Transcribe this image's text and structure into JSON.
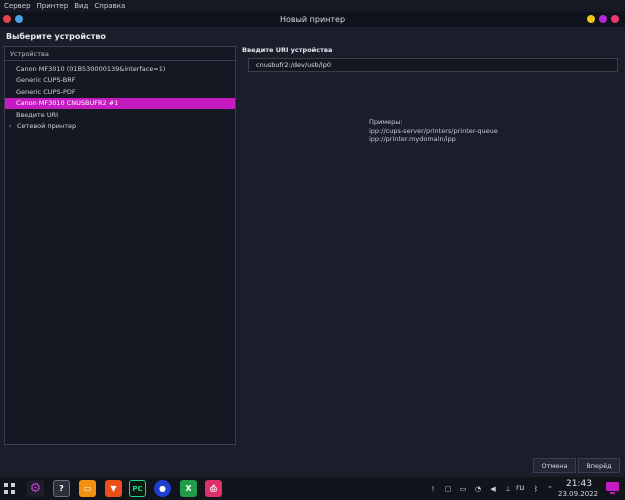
{
  "menubar": {
    "items": [
      "Сервер",
      "Принтер",
      "Вид",
      "Справка"
    ]
  },
  "window": {
    "title": "Новый принтер",
    "heading": "Выберите устройство"
  },
  "devices": {
    "header": "Устройства",
    "items": [
      {
        "label": "Canon MF3010 (01B530000139&interface=1)",
        "selected": false
      },
      {
        "label": "Generic CUPS-BRF",
        "selected": false
      },
      {
        "label": "Generic CUPS-PDF",
        "selected": false
      },
      {
        "label": "Canon MF3010 CNUSBUFR2 #1",
        "selected": true
      },
      {
        "label": "Введите URI",
        "selected": false
      },
      {
        "label": "Сетевой принтер",
        "selected": false,
        "expandable": true
      }
    ]
  },
  "uri": {
    "label": "Введите URI устройства",
    "value": "cnusbufr2:/dev/usb/lp0"
  },
  "examples": {
    "title": "Примеры:",
    "line1": "ipp://cups-server/printers/printer-queue",
    "line2": "ipp://printer.mydomain/ipp"
  },
  "buttons": {
    "cancel": "Отмена",
    "next": "Вперёд"
  },
  "taskbar": {
    "apps": [
      "settings-app",
      "help-app",
      "files-app",
      "brave-browser",
      "pycharm",
      "firefox",
      "libreoffice-calc",
      "printer-app"
    ],
    "language": "ru",
    "time": "21:43",
    "date": "23.09.2022"
  },
  "colors": {
    "accent": "#c41cc0",
    "background": "#1b1e2a"
  }
}
